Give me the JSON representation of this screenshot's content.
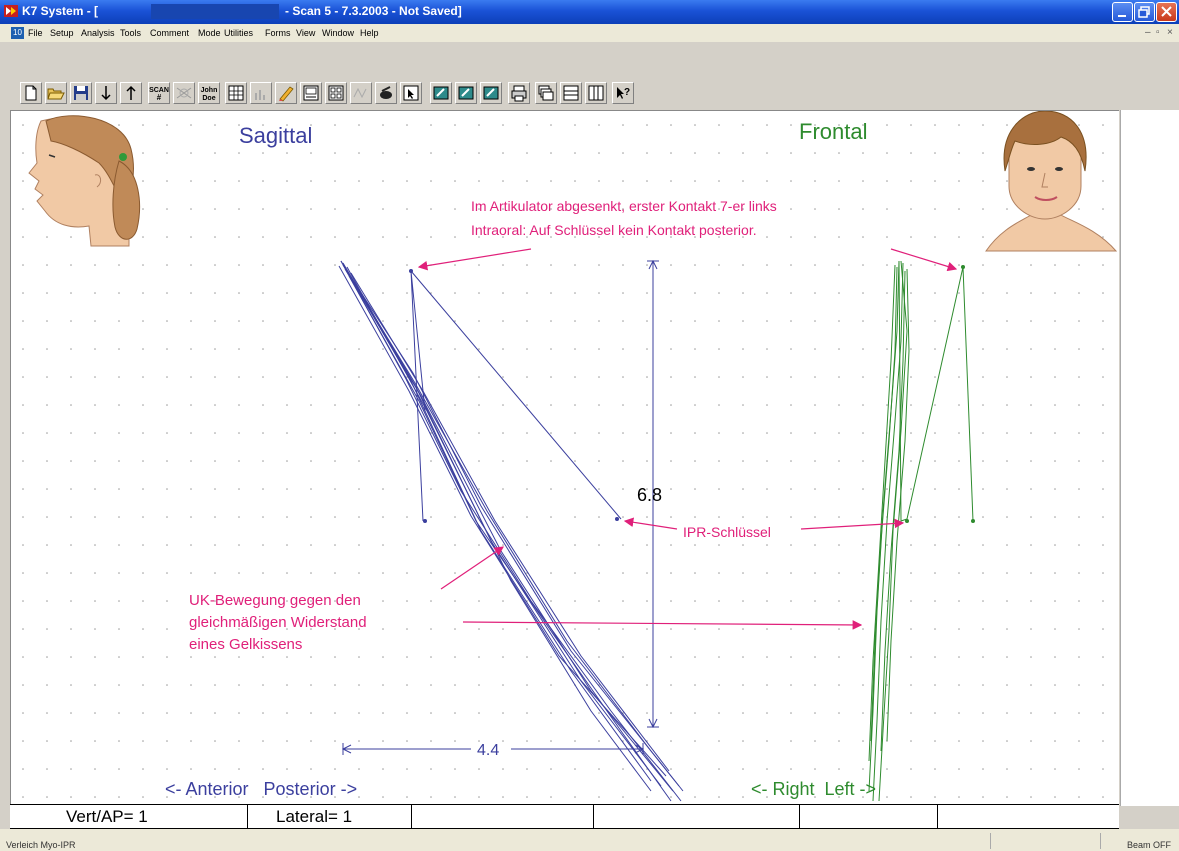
{
  "window": {
    "app_title": "K7 System - [",
    "doc_title": "- Scan 5 - 7.3.2003 - Not Saved]",
    "menu_icon_label": "10"
  },
  "menu": {
    "items": [
      "File",
      "Setup",
      "Analysis",
      "Tools",
      "Comment",
      "Mode",
      "Utilities",
      "Forms",
      "View",
      "Window",
      "Help"
    ]
  },
  "toolbar": {
    "scan_label": "SCAN",
    "scan_sub": "#",
    "patient_label_1": "John",
    "patient_label_2": "Doe",
    "help_label": "?"
  },
  "plot": {
    "sagittal_title": "Sagittal",
    "frontal_title": "Frontal",
    "annotation_line1": "Im Artikulator abgesenkt, erster Kontakt 7-er links",
    "annotation_line2": "Intraoral: Auf Schlüssel kein Kontakt posterior.",
    "ipr_label": "IPR-Schlüssel",
    "uk_line1": "UK-Bewegung gegen den",
    "uk_line2": "gleichmäßigen Widerstand",
    "uk_line3": "eines Gelkissens",
    "vertical_measure": "6.8",
    "horizontal_measure": "4.4",
    "sagittal_axis": "<- Anterior   Posterior ->",
    "frontal_axis": "<- Right  Left ->",
    "colors": {
      "sagittal": "#3b3f9e",
      "frontal": "#2e8b2e",
      "annotation": "#e0207a",
      "measure": "#3b3f9e"
    }
  },
  "scale_row": {
    "vert_ap": "Vert/AP= 1",
    "lateral": "Lateral= 1"
  },
  "statusbar": {
    "left": "Verleich Myo-IPR",
    "right": "Beam OFF"
  }
}
